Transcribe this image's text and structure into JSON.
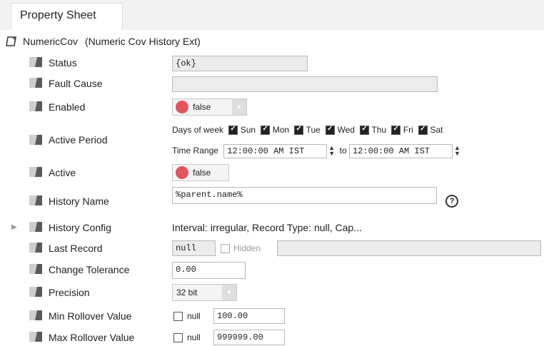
{
  "tab": {
    "label": "Property Sheet"
  },
  "root": {
    "name": "NumericCov",
    "type": "(Numeric Cov History Ext)"
  },
  "rows": {
    "status": {
      "label": "Status",
      "value": "{ok}"
    },
    "fault_cause": {
      "label": "Fault Cause",
      "value": ""
    },
    "enabled": {
      "label": "Enabled",
      "value": "false"
    },
    "active_period": {
      "label": "Active Period",
      "days_label": "Days of week",
      "days": [
        "Sun",
        "Mon",
        "Tue",
        "Wed",
        "Thu",
        "Fri",
        "Sat"
      ],
      "time_range_label": "Time Range",
      "start_time": "12:00:00 AM IST",
      "to_label": "to",
      "end_time": "12:00:00 AM IST"
    },
    "active": {
      "label": "Active",
      "value": "false"
    },
    "history_name": {
      "label": "History Name",
      "value": "%parent.name%"
    },
    "history_config": {
      "label": "History Config",
      "value": "Interval: irregular, Record Type: null, Cap..."
    },
    "last_record": {
      "label": "Last Record",
      "value": "null",
      "hidden_label": "Hidden",
      "hidden_value": ""
    },
    "change_tolerance": {
      "label": "Change Tolerance",
      "value": "0.00"
    },
    "precision": {
      "label": "Precision",
      "value": "32 bit"
    },
    "min_rollover": {
      "label": "Min Rollover Value",
      "null_label": "null",
      "value": "100.00"
    },
    "max_rollover": {
      "label": "Max Rollover Value",
      "null_label": "null",
      "value": "999999.00"
    }
  },
  "colors": {
    "status_red": "#e3545c"
  }
}
